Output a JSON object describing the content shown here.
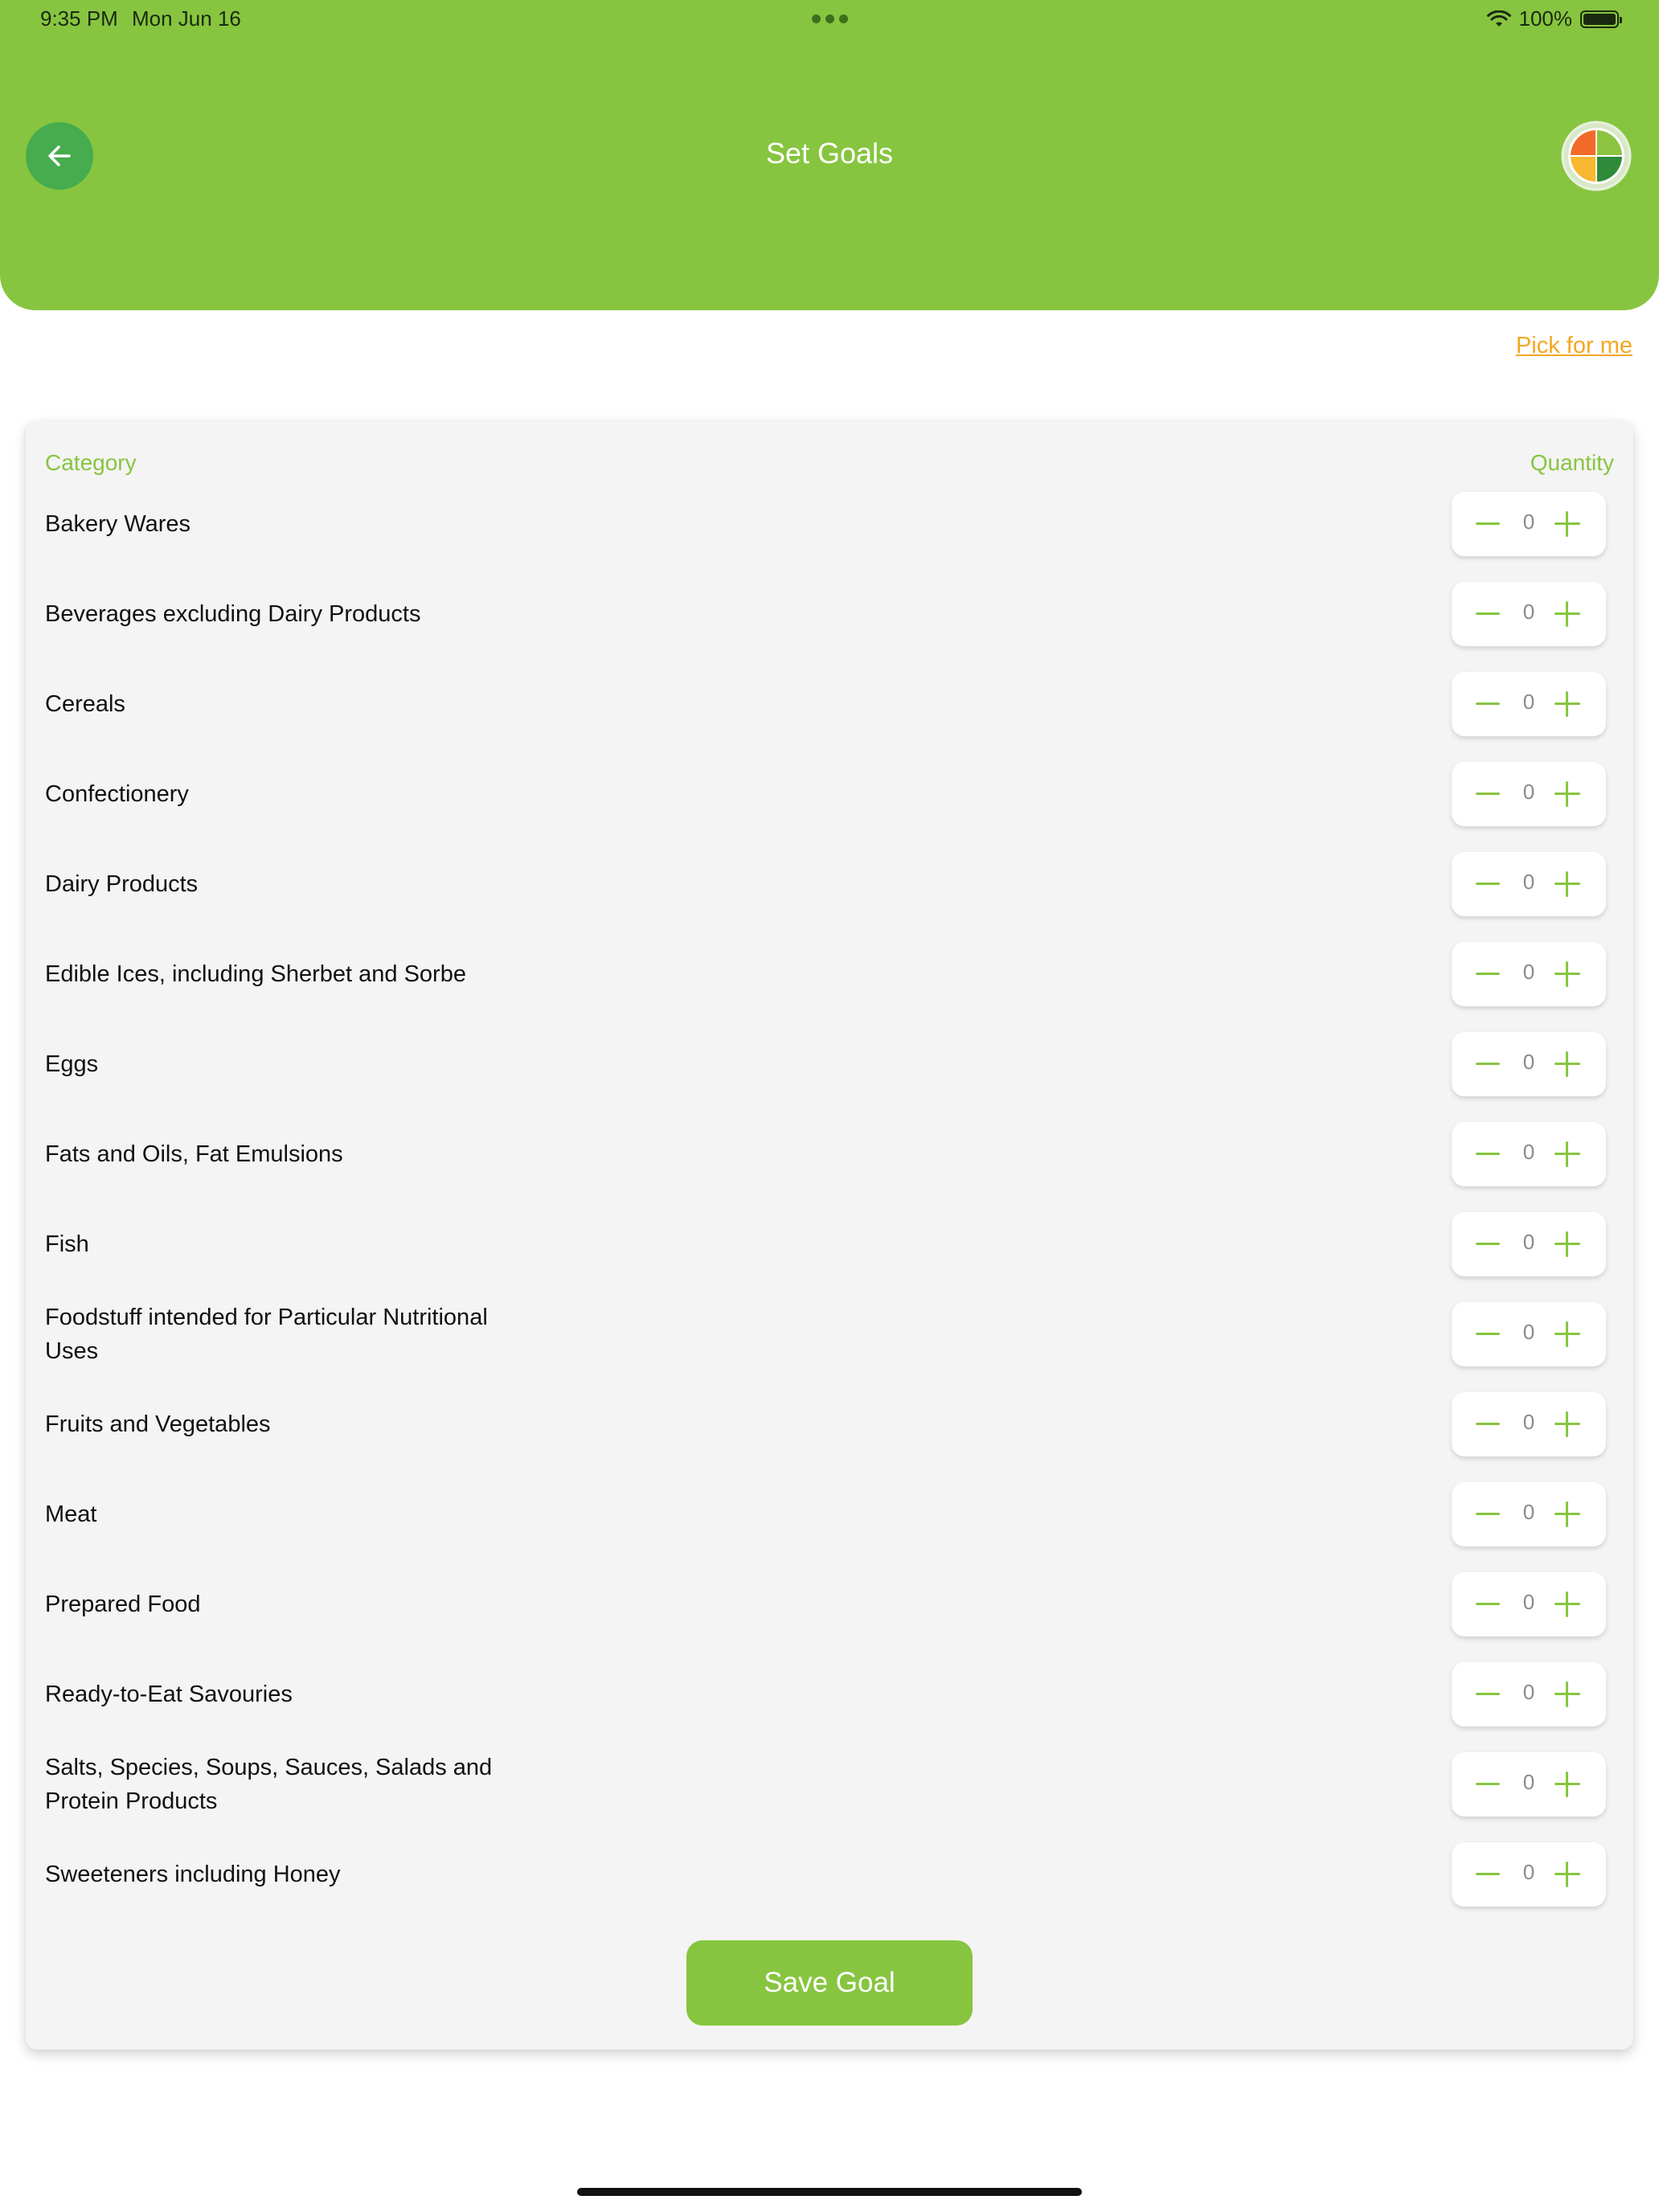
{
  "status_bar": {
    "time": "9:35 PM",
    "date": "Mon Jun 16",
    "battery": "100%",
    "battery_level": 1.0
  },
  "header": {
    "title": "Set Goals",
    "back_icon": "arrow-left-icon",
    "avatar_icon": "food-quadrant-logo-icon",
    "background": "#87c540"
  },
  "pick_for_me": "Pick for me",
  "table": {
    "category_header": "Category",
    "quantity_header": "Quantity",
    "rows": [
      {
        "label": "Bakery Wares",
        "qty": "0"
      },
      {
        "label": "Beverages excluding Dairy Products",
        "qty": "0"
      },
      {
        "label": "Cereals",
        "qty": "0"
      },
      {
        "label": "Confectionery",
        "qty": "0"
      },
      {
        "label": "Dairy Products",
        "qty": "0"
      },
      {
        "label": "Edible Ices, including Sherbet and Sorbe",
        "qty": "0"
      },
      {
        "label": "Eggs",
        "qty": "0"
      },
      {
        "label": "Fats and Oils, Fat Emulsions",
        "qty": "0"
      },
      {
        "label": "Fish",
        "qty": "0"
      },
      {
        "label": "Foodstuff intended for Particular Nutritional Uses",
        "qty": "0"
      },
      {
        "label": "Fruits and Vegetables",
        "qty": "0"
      },
      {
        "label": "Meat",
        "qty": "0"
      },
      {
        "label": "Prepared Food",
        "qty": "0"
      },
      {
        "label": "Ready-to-Eat Savouries",
        "qty": "0"
      },
      {
        "label": "Salts, Species, Soups, Sauces, Salads and Protein Products",
        "qty": "0"
      },
      {
        "label": "Sweeteners including Honey",
        "qty": "0"
      }
    ]
  },
  "save_button": "Save Goal",
  "colors": {
    "accent": "#87c540",
    "back_button": "#46ac4d",
    "link": "#f5a623"
  }
}
